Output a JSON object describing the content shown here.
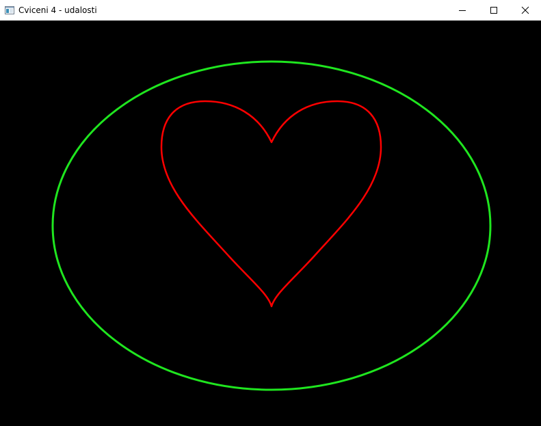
{
  "window": {
    "title": "Cviceni 4 - udalosti",
    "icon": "app-window-icon",
    "controls": {
      "minimize_icon": "minimize-icon",
      "maximize_icon": "maximize-icon",
      "close_icon": "close-icon"
    }
  },
  "canvas": {
    "background": "#000000",
    "shapes": [
      {
        "kind": "ellipse",
        "name": "green-ellipse",
        "color": "#1fe61f"
      },
      {
        "kind": "heart",
        "name": "red-heart",
        "color": "#ff0000"
      }
    ]
  }
}
